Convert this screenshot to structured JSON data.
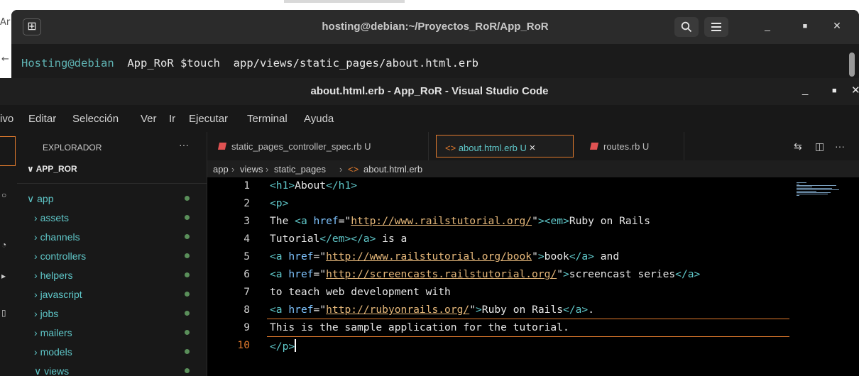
{
  "desktop": {
    "fragment_top": "Ar",
    "fragment_mid": "←"
  },
  "terminal": {
    "title": "hosting@debian:~/Proyectos_RoR/App_RoR",
    "prompt_user": "Hosting@debian",
    "prompt_dir": "App_RoR",
    "command": "$touch  app/views/static_pages/about.html.erb",
    "new_tab_icon": "⊞",
    "search_icon": "search-icon",
    "menu_icon": "hamburger-icon"
  },
  "vscode": {
    "window_title": "about.html.erb - App_RoR - Visual Studio Code",
    "menu": [
      "ivo",
      "Editar",
      "Selección",
      "Ver",
      "Ir",
      "Ejecutar",
      "Terminal",
      "Ayuda"
    ],
    "explorer": {
      "header": "EXPLORADOR",
      "more": "···",
      "project": "APP_ROR",
      "tree": [
        {
          "label": "app",
          "expanded": true,
          "indent": 1
        },
        {
          "label": "assets",
          "expanded": false,
          "indent": 2
        },
        {
          "label": "channels",
          "expanded": false,
          "indent": 2
        },
        {
          "label": "controllers",
          "expanded": false,
          "indent": 2
        },
        {
          "label": "helpers",
          "expanded": false,
          "indent": 2
        },
        {
          "label": "javascript",
          "expanded": false,
          "indent": 2
        },
        {
          "label": "jobs",
          "expanded": false,
          "indent": 2
        },
        {
          "label": "mailers",
          "expanded": false,
          "indent": 2
        },
        {
          "label": "models",
          "expanded": false,
          "indent": 2
        },
        {
          "label": "views",
          "expanded": true,
          "indent": 2
        }
      ]
    },
    "tabs": [
      {
        "label": "static_pages_controller_spec.rb U",
        "active": false
      },
      {
        "label": "about.html.erb U",
        "active": true
      },
      {
        "label": "routes.rb U",
        "active": false
      }
    ],
    "tab_close": "×",
    "tab_actions": [
      "⇆",
      "◫",
      "···"
    ],
    "breadcrumb": [
      "app",
      "views",
      "static_pages",
      "about.html.erb"
    ],
    "current_line": 10,
    "code_lines": [
      "<h1>About</h1>",
      "<p>",
      "The <a href=\"http://www.railstutorial.org/\"><em>Ruby on Rails",
      "Tutorial</em></a> is a",
      "<a href=\"http://www.railstutorial.org/book\">book</a> and",
      "<a href=\"http://screencasts.railstutorial.org/\">screencast series</a>",
      "to teach web development with",
      "<a href=\"http://rubyonrails.org/\">Ruby on Rails</a>.",
      "This is the sample application for the tutorial.",
      "</p>"
    ]
  },
  "colors": {
    "accent_orange": "#e07a2d",
    "tag_teal": "#5fc7c9",
    "string": "#e6b87a",
    "git_untracked_red": "#e05252"
  }
}
